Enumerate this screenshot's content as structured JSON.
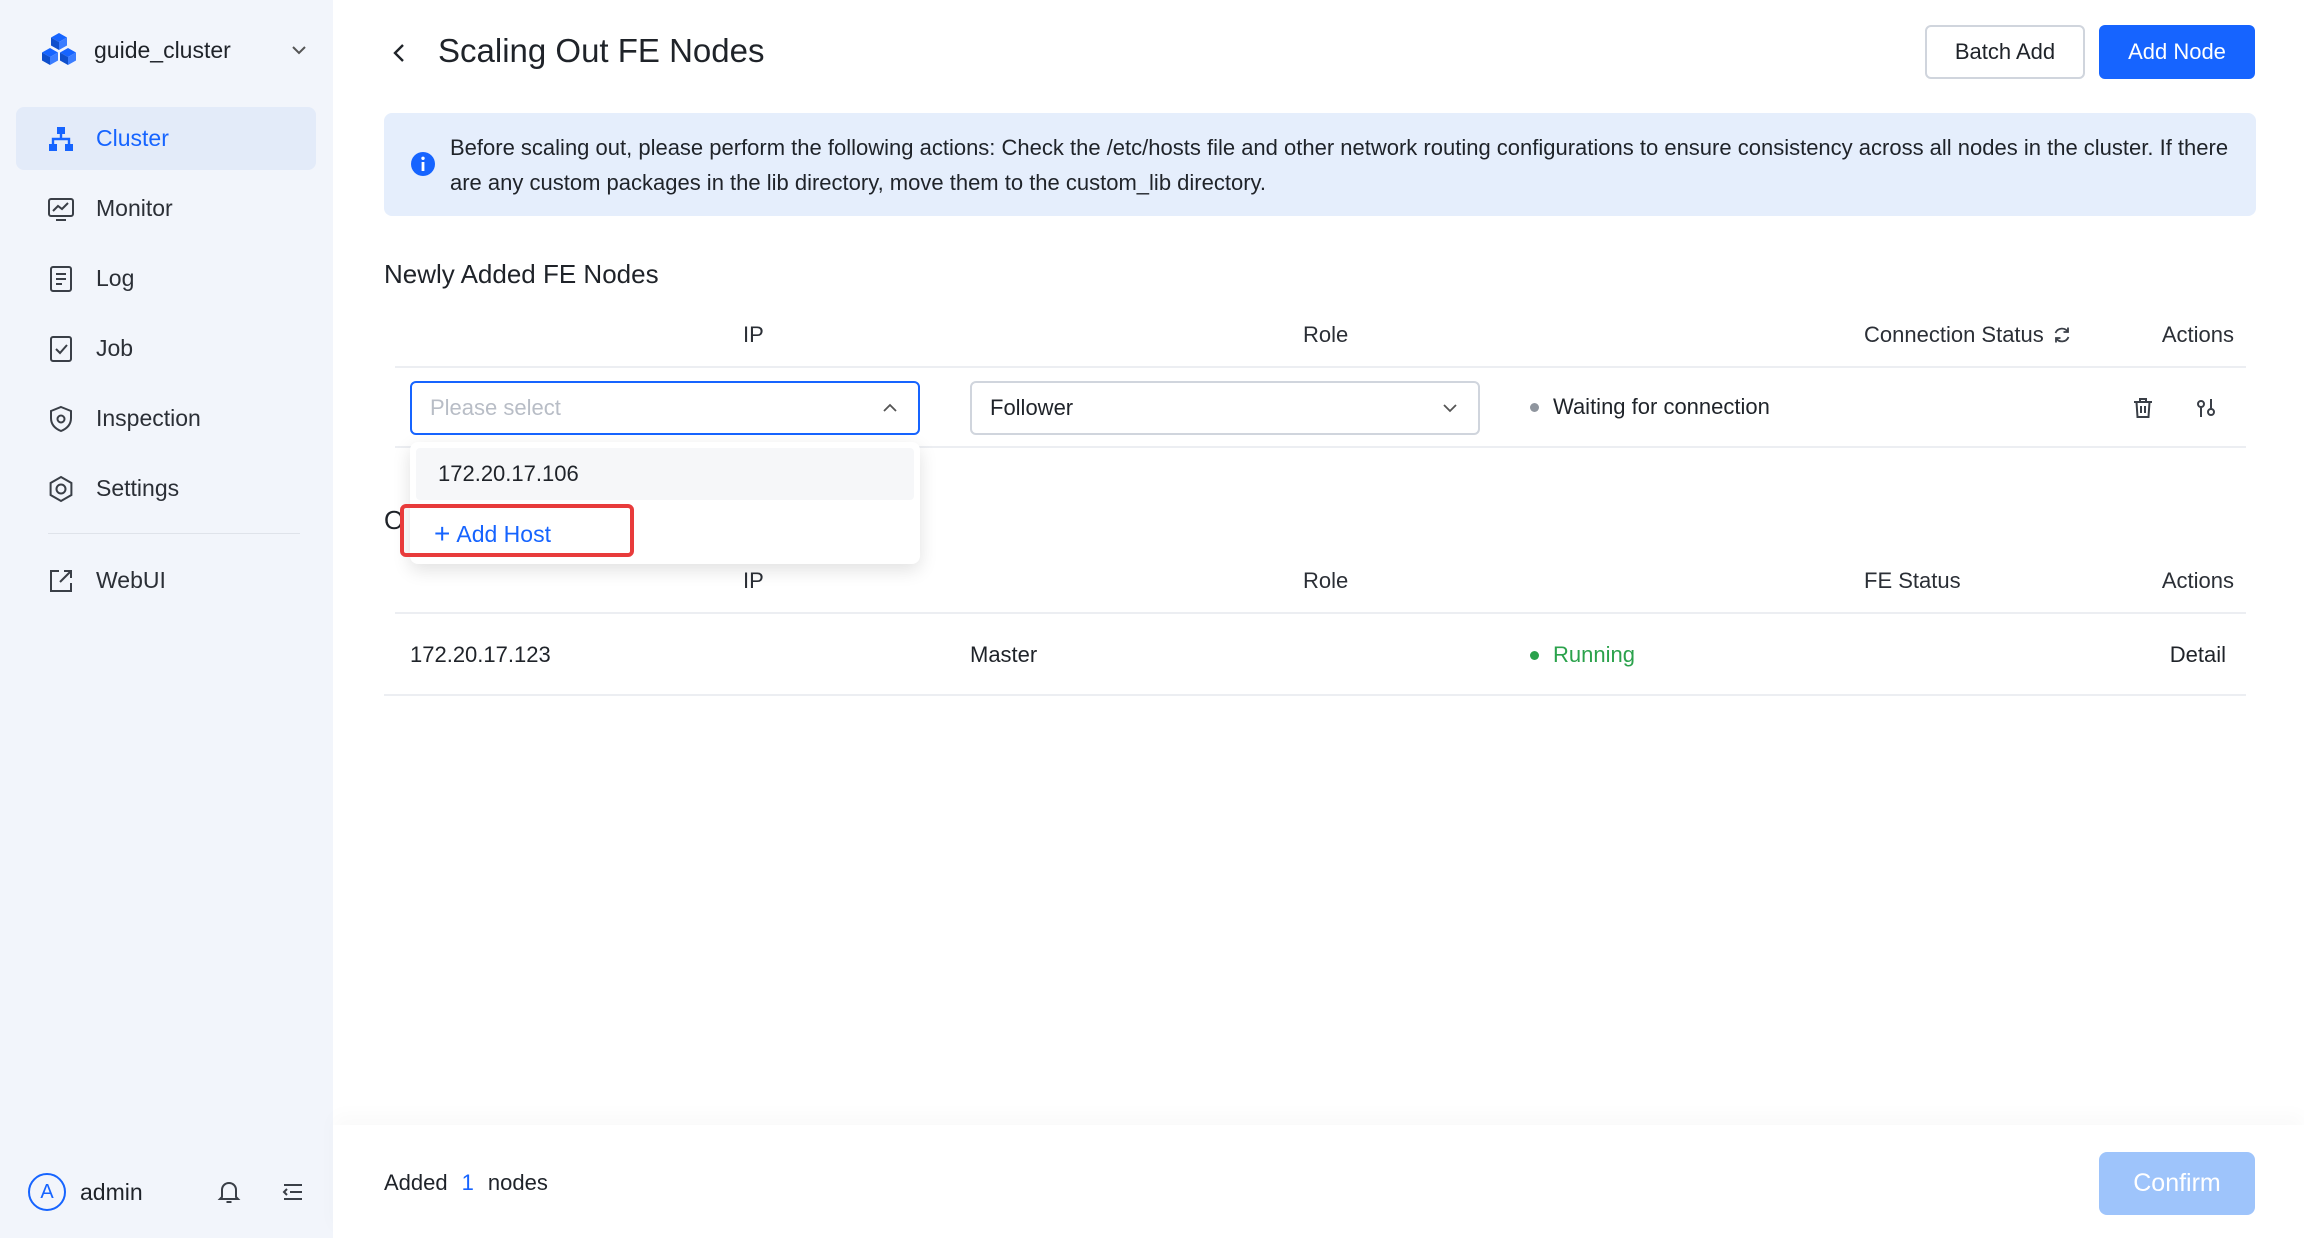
{
  "sidebar": {
    "cluster_name": "guide_cluster",
    "items": [
      {
        "label": "Cluster",
        "icon": "cluster-icon",
        "active": true
      },
      {
        "label": "Monitor",
        "icon": "monitor-icon"
      },
      {
        "label": "Log",
        "icon": "log-icon"
      },
      {
        "label": "Job",
        "icon": "job-icon"
      },
      {
        "label": "Inspection",
        "icon": "inspection-icon"
      },
      {
        "label": "Settings",
        "icon": "settings-icon"
      },
      {
        "label": "WebUI",
        "icon": "external-link-icon"
      }
    ],
    "user": {
      "avatar_letter": "A",
      "name": "admin"
    }
  },
  "header": {
    "title": "Scaling Out FE Nodes",
    "batch_add_label": "Batch Add",
    "add_node_label": "Add Node"
  },
  "alert": {
    "text": "Before scaling out, please perform the following actions: Check the /etc/hosts file and other network routing configurations to ensure consistency across all nodes in the cluster. If there are any custom packages in the lib directory, move them to the custom_lib directory."
  },
  "new_nodes": {
    "title": "Newly Added FE Nodes",
    "columns": {
      "ip": "IP",
      "role": "Role",
      "status": "Connection Status",
      "actions": "Actions"
    },
    "row": {
      "ip_placeholder": "Please select",
      "role_value": "Follower",
      "status_text": "Waiting for connection"
    },
    "dropdown": {
      "options": [
        "172.20.17.106"
      ],
      "add_host_label": "Add Host"
    }
  },
  "existing_nodes": {
    "title_partial": "O",
    "columns": {
      "ip": "IP",
      "role": "Role",
      "status": "FE Status",
      "actions": "Actions"
    },
    "rows": [
      {
        "ip": "172.20.17.123",
        "role": "Master",
        "status": "Running",
        "action": "Detail"
      }
    ]
  },
  "footer": {
    "added_prefix": "Added",
    "added_count": "1",
    "added_suffix": "nodes",
    "confirm_label": "Confirm"
  },
  "colors": {
    "accent": "#1664ff",
    "running": "#2ba24c",
    "waiting": "#8f959e",
    "highlight": "#e83b3b",
    "sidebar_bg": "#f2f5fb"
  }
}
